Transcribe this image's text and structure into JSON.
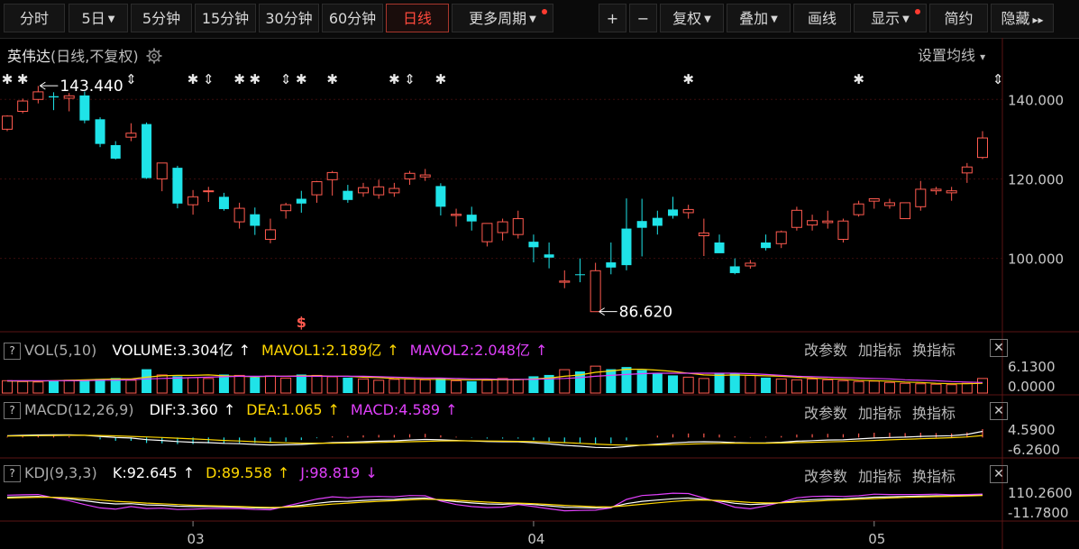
{
  "toolbar": {
    "buttons": [
      {
        "label": "分时",
        "caret": false,
        "dot": false,
        "active": false
      },
      {
        "label": "5日",
        "caret": true,
        "dot": false,
        "active": false
      },
      {
        "label": "5分钟",
        "caret": false,
        "dot": false,
        "active": false
      },
      {
        "label": "15分钟",
        "caret": false,
        "dot": false,
        "active": false
      },
      {
        "label": "30分钟",
        "caret": false,
        "dot": false,
        "active": false
      },
      {
        "label": "60分钟",
        "caret": false,
        "dot": false,
        "active": false
      },
      {
        "label": "日线",
        "caret": false,
        "dot": false,
        "active": true
      },
      {
        "label": "更多周期",
        "caret": true,
        "dot": true,
        "active": false
      },
      {
        "label": "+",
        "caret": false,
        "dot": false,
        "active": false
      },
      {
        "label": "−",
        "caret": false,
        "dot": false,
        "active": false
      },
      {
        "label": "复权",
        "caret": true,
        "dot": false,
        "active": false
      },
      {
        "label": "叠加",
        "caret": true,
        "dot": false,
        "active": false
      },
      {
        "label": "画线",
        "caret": false,
        "dot": false,
        "active": false
      },
      {
        "label": "显示",
        "caret": true,
        "dot": true,
        "active": false
      },
      {
        "label": "简约",
        "caret": false,
        "dot": false,
        "active": false
      },
      {
        "label": "隐藏",
        "caret": false,
        "dot": false,
        "active": false,
        "suffix": "▸▸"
      }
    ],
    "caret_glyph": "▼"
  },
  "header": {
    "stock_name": "英伟达",
    "mode": "(日线,不复权)",
    "settings_icon": "gear-icon",
    "ma_settings": "设置均线",
    "ma_caret": "▾"
  },
  "colors": {
    "up": "#ff5a4f",
    "down": "#1fe3e8",
    "grid": "#3a0d0d",
    "axis_text": "#c8c8c8",
    "yellow": "#ffd700",
    "magenta": "#e040fb",
    "white": "#ffffff"
  },
  "chart_data": {
    "type": "candlestick",
    "title": "英伟达 (日线,不复权)",
    "ylim": [
      82,
      148
    ],
    "yticks": [
      100,
      120,
      140
    ],
    "ytick_labels": [
      "100.000",
      "120.000",
      "140.000"
    ],
    "xtick_labels": [
      "03",
      "04",
      "05"
    ],
    "xtick_index": [
      12,
      34,
      56
    ],
    "max_annotation": {
      "label": "143.440",
      "value": 143.44,
      "index": 2
    },
    "min_annotation": {
      "label": "86.620",
      "value": 86.62,
      "index": 38
    },
    "marker_row": [
      0,
      1,
      8,
      12,
      13,
      15,
      16,
      18,
      19,
      21,
      25,
      26,
      28,
      44,
      55,
      64
    ],
    "marker_glyphs": [
      "✱",
      "✱",
      "⇕",
      "✱",
      "⇕",
      "✱",
      "✱",
      "⇕",
      "✱",
      "✱",
      "✱",
      "⇕",
      "✱",
      "✱",
      "✱",
      "⇕"
    ],
    "signal": {
      "label": "$",
      "index": 19
    },
    "ohlc": [
      [
        132.5,
        136.0,
        132.0,
        135.8
      ],
      [
        137.0,
        140.2,
        136.5,
        139.6
      ],
      [
        140.0,
        143.4,
        139.0,
        141.9
      ],
      [
        140.8,
        141.8,
        137.3,
        140.5
      ],
      [
        140.3,
        141.6,
        137.0,
        140.9
      ],
      [
        141.0,
        142.0,
        134.0,
        134.7
      ],
      [
        135.0,
        135.5,
        128.0,
        128.8
      ],
      [
        128.5,
        129.5,
        124.9,
        125.1
      ],
      [
        130.5,
        134.0,
        129.5,
        131.5
      ],
      [
        133.8,
        134.2,
        120.0,
        120.2
      ],
      [
        120.0,
        124.0,
        116.9,
        124.0
      ],
      [
        122.8,
        123.3,
        112.6,
        113.8
      ],
      [
        113.5,
        117.2,
        111.0,
        115.5
      ],
      [
        117.0,
        118.0,
        114.2,
        117.0
      ],
      [
        115.5,
        116.5,
        112.0,
        112.4
      ],
      [
        109.2,
        114.0,
        107.5,
        112.6
      ],
      [
        111.1,
        112.8,
        105.9,
        108.2
      ],
      [
        104.8,
        110.0,
        103.8,
        107.2
      ],
      [
        112.0,
        114.0,
        110.0,
        113.5
      ],
      [
        115.0,
        117.0,
        111.5,
        113.8
      ],
      [
        116.0,
        119.5,
        114.0,
        119.3
      ],
      [
        119.8,
        122.0,
        115.8,
        121.6
      ],
      [
        117.0,
        118.5,
        114.0,
        114.7
      ],
      [
        116.5,
        119.0,
        115.5,
        117.8
      ],
      [
        116.0,
        119.8,
        115.0,
        118.0
      ],
      [
        116.5,
        119.0,
        115.5,
        117.6
      ],
      [
        120.0,
        122.0,
        118.5,
        121.4
      ],
      [
        120.5,
        122.5,
        119.5,
        121.0
      ],
      [
        118.2,
        118.9,
        110.8,
        113.0
      ],
      [
        110.8,
        112.5,
        108.0,
        111.1
      ],
      [
        111.0,
        113.0,
        107.0,
        109.3
      ],
      [
        104.2,
        108.0,
        103.0,
        108.8
      ],
      [
        106.5,
        110.0,
        104.5,
        109.2
      ],
      [
        106.0,
        112.0,
        105.0,
        110.0
      ],
      [
        104.2,
        106.0,
        99.0,
        102.8
      ],
      [
        101.0,
        104.0,
        97.5,
        100.2
      ],
      [
        94.0,
        97.0,
        92.5,
        94.3
      ],
      [
        96.0,
        100.0,
        94.0,
        95.9
      ],
      [
        86.6,
        98.9,
        86.6,
        96.9
      ],
      [
        99.0,
        104.0,
        96.0,
        97.7
      ],
      [
        107.5,
        115.1,
        97.0,
        98.3
      ],
      [
        109.4,
        115.0,
        100.5,
        107.7
      ],
      [
        110.2,
        112.0,
        106.0,
        108.2
      ],
      [
        112.3,
        115.5,
        110.0,
        110.7
      ],
      [
        111.5,
        113.5,
        110.0,
        112.3
      ],
      [
        105.7,
        110.0,
        100.6,
        106.4
      ],
      [
        104.0,
        106.0,
        102.0,
        101.3
      ],
      [
        98.0,
        100.0,
        96.0,
        96.3
      ],
      [
        98.1,
        99.6,
        97.4,
        98.8
      ],
      [
        104.0,
        106.0,
        102.0,
        102.6
      ],
      [
        103.7,
        107.0,
        102.6,
        106.7
      ],
      [
        107.8,
        113.0,
        107.0,
        112.1
      ],
      [
        108.4,
        111.0,
        107.0,
        109.5
      ],
      [
        109.0,
        112.0,
        107.5,
        109.4
      ],
      [
        104.8,
        110.0,
        104.0,
        109.4
      ],
      [
        111.0,
        114.5,
        110.5,
        113.7
      ],
      [
        114.4,
        115.0,
        112.5,
        115.0
      ],
      [
        113.3,
        115.0,
        112.5,
        114.0
      ],
      [
        110.0,
        114.0,
        110.0,
        114.0
      ],
      [
        113.0,
        119.5,
        112.0,
        117.4
      ],
      [
        117.0,
        118.0,
        116.0,
        117.4
      ],
      [
        116.5,
        118.0,
        114.5,
        117.0
      ],
      [
        121.5,
        124.0,
        119.0,
        123.0
      ],
      [
        125.4,
        132.0,
        125.0,
        130.3
      ]
    ],
    "ma_lines": {
      "colors": [
        "#ffffff",
        "#ffd700",
        "#e040fb"
      ]
    },
    "volume": {
      "title": "VOL(5,10)",
      "ylim": [
        0,
        6.13
      ],
      "ytick_labels": [
        "6.1300",
        "0.0000"
      ],
      "legend": [
        {
          "label": "VOLUME:3.304亿",
          "arrow": "↑",
          "color": "#ffffff"
        },
        {
          "label": "MAVOL1:2.189亿",
          "arrow": "↑",
          "color": "#ffd700"
        },
        {
          "label": "MAVOL2:2.048亿",
          "arrow": "↑",
          "color": "#e040fb"
        }
      ],
      "values": [
        2.8,
        2.6,
        2.5,
        2.7,
        2.9,
        3.0,
        3.2,
        3.4,
        2.9,
        5.4,
        4.1,
        3.8,
        3.5,
        3.3,
        4.2,
        4.0,
        3.6,
        3.9,
        3.4,
        4.2,
        4.0,
        3.7,
        3.5,
        3.2,
        2.9,
        3.1,
        3.2,
        3.0,
        3.3,
        2.8,
        2.7,
        2.9,
        3.3,
        3.1,
        3.8,
        4.1,
        5.3,
        4.9,
        6.1,
        5.4,
        5.9,
        5.2,
        4.4,
        4.0,
        3.6,
        3.3,
        4.6,
        4.4,
        4.0,
        3.5,
        3.2,
        3.0,
        3.2,
        3.0,
        2.8,
        2.6,
        2.7,
        2.4,
        2.2,
        2.1,
        2.0,
        1.9,
        2.2,
        3.3
      ],
      "mavol1": [
        2.7,
        2.7,
        2.7,
        2.8,
        2.9,
        3.0,
        3.1,
        3.2,
        3.2,
        3.6,
        3.9,
        4.0,
        4.0,
        4.1,
        3.9,
        3.8,
        3.7,
        3.8,
        3.8,
        3.9,
        3.9,
        3.8,
        3.8,
        3.6,
        3.5,
        3.3,
        3.2,
        3.1,
        3.1,
        3.0,
        3.0,
        3.0,
        3.0,
        3.0,
        3.2,
        3.4,
        3.8,
        4.1,
        4.7,
        5.0,
        5.4,
        5.4,
        5.2,
        4.9,
        4.5,
        4.1,
        4.0,
        4.1,
        4.0,
        3.9,
        3.8,
        3.6,
        3.4,
        3.2,
        3.1,
        2.9,
        2.8,
        2.7,
        2.5,
        2.4,
        2.2,
        2.1,
        2.1,
        2.2
      ],
      "mavol2": [
        2.8,
        2.8,
        2.8,
        2.8,
        2.8,
        2.8,
        2.9,
        2.9,
        3.0,
        3.2,
        3.3,
        3.4,
        3.5,
        3.6,
        3.7,
        3.8,
        3.8,
        3.8,
        3.8,
        3.8,
        3.8,
        3.8,
        3.8,
        3.8,
        3.7,
        3.6,
        3.5,
        3.4,
        3.4,
        3.3,
        3.2,
        3.2,
        3.1,
        3.1,
        3.1,
        3.2,
        3.3,
        3.5,
        3.8,
        4.0,
        4.2,
        4.4,
        4.5,
        4.5,
        4.5,
        4.5,
        4.5,
        4.5,
        4.4,
        4.2,
        4.0,
        3.8,
        3.7,
        3.6,
        3.5,
        3.4,
        3.3,
        3.2,
        3.0,
        2.9,
        2.8,
        2.6,
        2.5,
        2.4
      ]
    },
    "macd": {
      "title": "MACD(12,26,9)",
      "ylim": [
        -6.26,
        4.59
      ],
      "ytick_labels": [
        "4.5900",
        "-6.2600"
      ],
      "legend": [
        {
          "label": "DIF:3.360",
          "arrow": "↑",
          "color": "#ffffff"
        },
        {
          "label": "DEA:1.065",
          "arrow": "↑",
          "color": "#ffd700"
        },
        {
          "label": "MACD:4.589",
          "arrow": "↑",
          "color": "#e040fb"
        }
      ],
      "dif": [
        1.0,
        1.2,
        1.4,
        1.5,
        1.5,
        1.2,
        0.6,
        0.0,
        -0.3,
        -1.2,
        -1.6,
        -2.2,
        -2.6,
        -2.8,
        -3.2,
        -3.4,
        -3.8,
        -4.1,
        -4.0,
        -3.8,
        -3.3,
        -2.8,
        -2.6,
        -2.3,
        -2.0,
        -1.8,
        -1.4,
        -1.1,
        -1.3,
        -1.6,
        -1.9,
        -2.2,
        -2.3,
        -2.4,
        -2.9,
        -3.5,
        -4.3,
        -4.8,
        -5.4,
        -5.6,
        -5.0,
        -4.2,
        -3.6,
        -3.0,
        -2.5,
        -2.3,
        -2.4,
        -2.8,
        -3.0,
        -2.9,
        -2.6,
        -2.0,
        -1.7,
        -1.4,
        -1.3,
        -0.8,
        -0.3,
        0.0,
        0.2,
        0.6,
        0.8,
        1.0,
        1.7,
        3.36
      ],
      "dea": [
        0.8,
        0.9,
        1.0,
        1.1,
        1.2,
        1.2,
        1.1,
        0.9,
        0.6,
        0.3,
        0.0,
        -0.4,
        -0.8,
        -1.2,
        -1.6,
        -1.9,
        -2.3,
        -2.6,
        -2.9,
        -3.1,
        -3.1,
        -3.1,
        -3.0,
        -2.9,
        -2.7,
        -2.5,
        -2.3,
        -2.1,
        -1.9,
        -1.8,
        -1.8,
        -1.9,
        -2.0,
        -2.1,
        -2.2,
        -2.5,
        -2.8,
        -3.2,
        -3.6,
        -4.0,
        -4.2,
        -4.2,
        -4.1,
        -3.9,
        -3.6,
        -3.4,
        -3.2,
        -3.1,
        -3.1,
        -3.1,
        -3.0,
        -2.8,
        -2.6,
        -2.4,
        -2.2,
        -1.9,
        -1.6,
        -1.3,
        -1.0,
        -0.7,
        -0.4,
        -0.1,
        0.3,
        1.065
      ]
    },
    "kdj": {
      "title": "KDJ(9,3,3)",
      "ylim": [
        -11.78,
        110.26
      ],
      "ytick_labels": [
        "110.2600",
        "-11.7800"
      ],
      "legend": [
        {
          "label": "K:92.645",
          "arrow": "↑",
          "color": "#ffffff"
        },
        {
          "label": "D:89.558",
          "arrow": "↑",
          "color": "#ffd700"
        },
        {
          "label": "J:98.819",
          "arrow": "↓",
          "color": "#e040fb"
        }
      ],
      "k": [
        80,
        82,
        84,
        78,
        70,
        58,
        46,
        38,
        40,
        32,
        30,
        24,
        22,
        22,
        20,
        18,
        14,
        12,
        20,
        30,
        42,
        52,
        54,
        60,
        64,
        66,
        72,
        74,
        62,
        52,
        44,
        38,
        36,
        40,
        34,
        26,
        18,
        16,
        14,
        18,
        40,
        54,
        62,
        70,
        74,
        66,
        56,
        42,
        34,
        38,
        46,
        58,
        64,
        68,
        70,
        74,
        80,
        82,
        84,
        86,
        88,
        88,
        90,
        92.6
      ],
      "d": [
        74,
        77,
        79,
        79,
        76,
        70,
        62,
        54,
        49,
        43,
        39,
        34,
        30,
        27,
        25,
        22,
        19,
        17,
        18,
        22,
        29,
        37,
        43,
        49,
        54,
        58,
        63,
        67,
        65,
        61,
        55,
        49,
        45,
        43,
        40,
        35,
        29,
        25,
        21,
        20,
        27,
        36,
        45,
        53,
        60,
        62,
        60,
        54,
        47,
        44,
        45,
        49,
        54,
        59,
        63,
        67,
        71,
        75,
        78,
        81,
        83,
        85,
        87,
        89.6
      ],
      "j": [
        92,
        94,
        96,
        76,
        58,
        34,
        14,
        6,
        22,
        10,
        12,
        4,
        6,
        10,
        10,
        10,
        4,
        2,
        24,
        46,
        68,
        82,
        76,
        82,
        84,
        82,
        90,
        88,
        56,
        34,
        22,
        16,
        18,
        34,
        22,
        8,
        -4,
        -2,
        0,
        14,
        66,
        90,
        96,
        104,
        102,
        74,
        48,
        18,
        8,
        26,
        48,
        76,
        84,
        86,
        84,
        88,
        98,
        96,
        96,
        96,
        98,
        94,
        96,
        98.8
      ]
    }
  },
  "panes": {
    "actions": [
      "改参数",
      "加指标",
      "换指标"
    ],
    "help_glyph": "?",
    "close_glyph": "✕"
  }
}
